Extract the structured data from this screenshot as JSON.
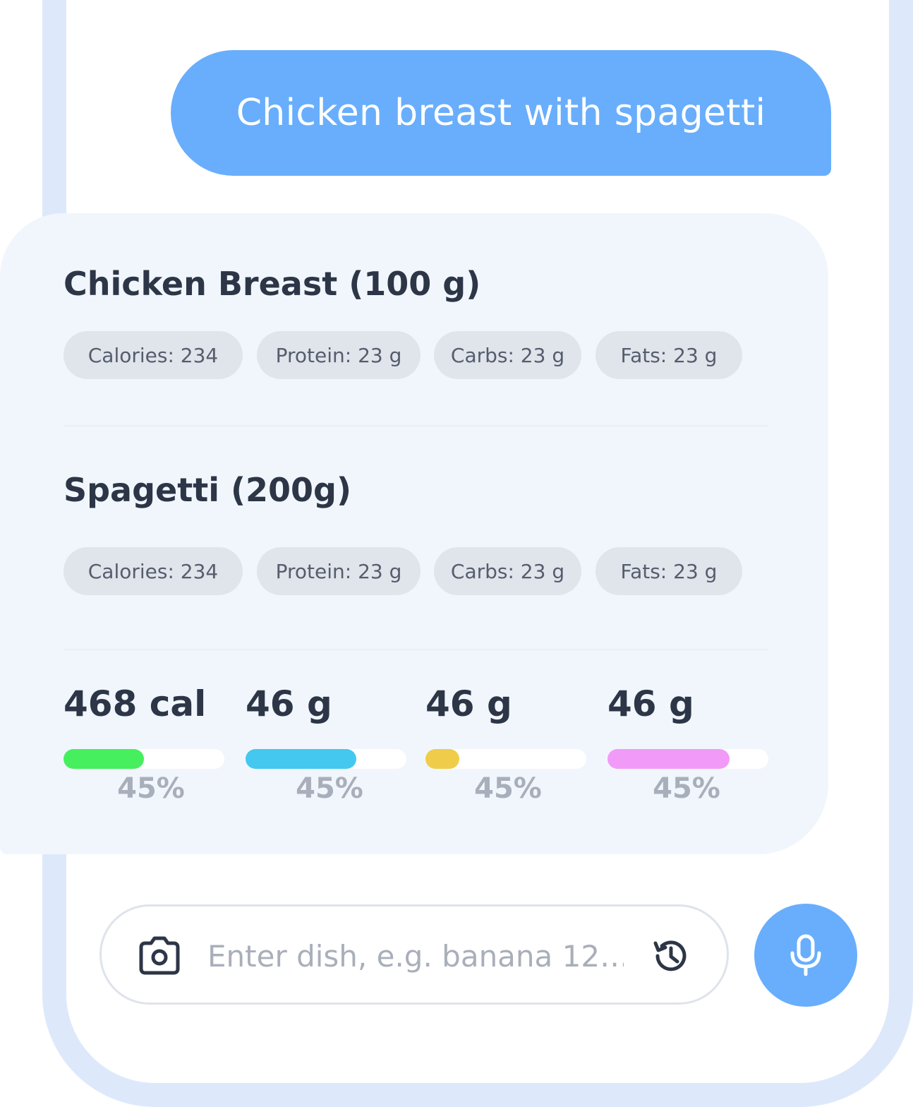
{
  "chat": {
    "user_message": "Chicken breast with spagetti"
  },
  "result": {
    "foods": [
      {
        "title": "Chicken Breast (100 g)",
        "chips": [
          "Calories: 234",
          "Protein: 23 g",
          "Carbs: 23 g",
          "Fats: 23 g"
        ]
      },
      {
        "title": "Spagetti (200g)",
        "chips": [
          "Calories: 234",
          "Protein: 23 g",
          "Carbs: 23 g",
          "Fats: 23 g"
        ]
      }
    ],
    "totals": [
      {
        "value": "468 cal",
        "percent_label": "45%",
        "fill": 0.5,
        "color": "#46ef5e"
      },
      {
        "value": "46 g",
        "percent_label": "45%",
        "fill": 0.69,
        "color": "#44c8ef"
      },
      {
        "value": "46 g",
        "percent_label": "45%",
        "fill": 0.21,
        "color": "#efcd4a"
      },
      {
        "value": "46 g",
        "percent_label": "45%",
        "fill": 0.76,
        "color": "#f29af8"
      }
    ]
  },
  "composer": {
    "placeholder": "Enter dish, e.g. banana 12…",
    "camera_icon": "camera-icon",
    "history_icon": "history-icon",
    "mic_icon": "microphone-icon"
  },
  "colors": {
    "accent": "#68aefc",
    "frame": "#dde9fb",
    "card": "#f1f6fd",
    "chip": "#e0e4eb",
    "text_dark": "#2d3647",
    "text_muted": "#a9afba"
  }
}
